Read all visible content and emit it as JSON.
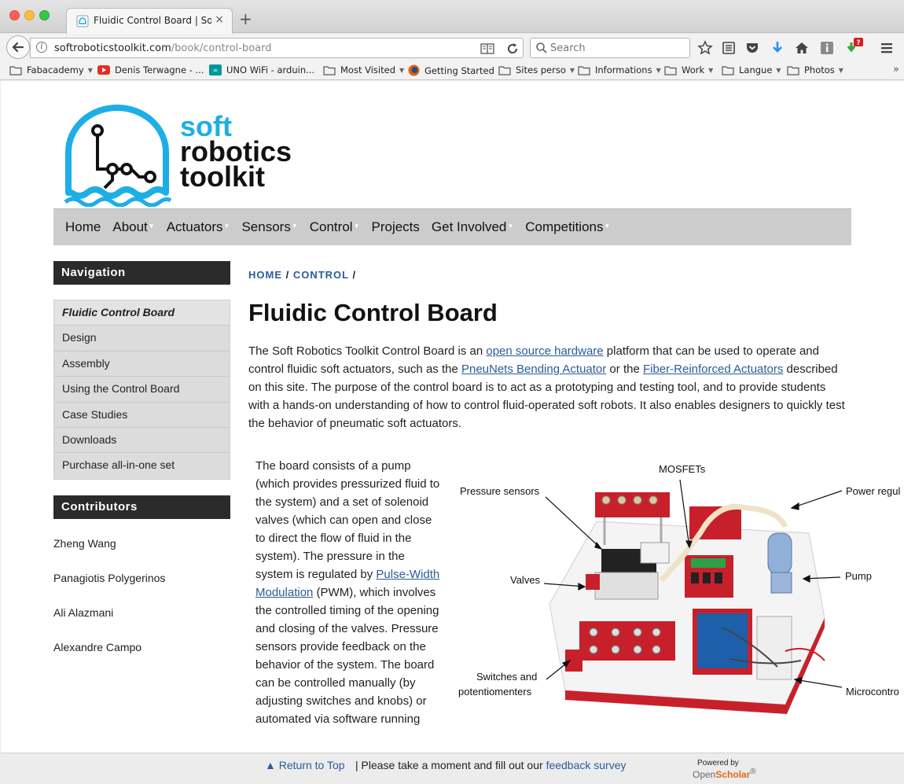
{
  "browser": {
    "tab_title": "Fluidic Control Board | Soft Ro",
    "url_host": "softroboticstoolkit.com",
    "url_path": "/book/control-board",
    "search_placeholder": "Search",
    "update_badge": "?"
  },
  "bookmarks": [
    {
      "label": "Fabacademy",
      "caret": true,
      "icon": "folder-icon"
    },
    {
      "label": "Denis Terwagne - ...",
      "caret": false,
      "icon": "youtube-icon"
    },
    {
      "label": "UNO WiFi - arduin...",
      "caret": false,
      "icon": "arduino-icon"
    },
    {
      "label": "Most Visited",
      "caret": true,
      "icon": "folder-icon"
    },
    {
      "label": "Getting Started",
      "caret": false,
      "icon": "firefox-icon"
    },
    {
      "label": "Sites perso",
      "caret": true,
      "icon": "folder-icon"
    },
    {
      "label": "Informations",
      "caret": true,
      "icon": "folder-icon"
    },
    {
      "label": "Work",
      "caret": true,
      "icon": "folder-icon"
    },
    {
      "label": "Langue",
      "caret": true,
      "icon": "folder-icon"
    },
    {
      "label": "Photos",
      "caret": true,
      "icon": "folder-icon"
    }
  ],
  "logo": {
    "line1": "soft",
    "line2": "robotics",
    "line3": "toolkit"
  },
  "menu": [
    {
      "label": "Home",
      "caret": false
    },
    {
      "label": "About",
      "caret": true
    },
    {
      "label": "Actuators",
      "caret": true
    },
    {
      "label": "Sensors",
      "caret": true
    },
    {
      "label": "Control",
      "caret": true
    },
    {
      "label": "Projects",
      "caret": false
    },
    {
      "label": "Get Involved",
      "caret": true
    },
    {
      "label": "Competitions",
      "caret": true
    }
  ],
  "sidebar": {
    "nav_heading": "Navigation",
    "nav_items": [
      {
        "label": "Fluidic Control Board",
        "active": true
      },
      {
        "label": "Design",
        "active": false
      },
      {
        "label": "Assembly",
        "active": false
      },
      {
        "label": "Using the Control Board",
        "active": false
      },
      {
        "label": "Case Studies",
        "active": false
      },
      {
        "label": "Downloads",
        "active": false
      },
      {
        "label": "Purchase all-in-one set",
        "active": false
      }
    ],
    "contributors_heading": "Contributors",
    "contributors": [
      "Zheng Wang",
      "Panagiotis Polygerinos",
      "Ali Alazmani",
      "Alexandre Campo"
    ]
  },
  "breadcrumb": {
    "home": "HOME",
    "sep": " / ",
    "control": "CONTROL",
    "trail": " /"
  },
  "article": {
    "title": "Fluidic Control Board",
    "intro": {
      "t1": "The Soft Robotics Toolkit Control Board is an ",
      "l1": "open source hardware",
      "t2": " platform that can be used to operate and control fluidic soft actuators, such as the ",
      "l2": "PneuNets Bending Actuator",
      "t3": " or the ",
      "l3": "Fiber-Reinforced Actuators",
      "t4": " described on this site. The purpose of the control board is to act as a prototyping and testing tool, and to provide students with a hands-on understanding of how to control fluid-operated soft robots. It also enables designers to quickly test the behavior of pneumatic soft actuators."
    },
    "body": {
      "t1": "The board consists of a pump (which provides pressurized fluid to the system) and a set of solenoid valves (which can open and close to direct the flow of fluid in the system). The pressure in the system is regulated by ",
      "l1": "Pulse-Width Modulation",
      "t2": " (PWM), which involves the controlled timing of the opening and closing of the valves. Pressure sensors provide feedback on the behavior of the system. The board can be controlled manually (by adjusting switches and knobs) or automated via software running"
    }
  },
  "figure": {
    "mosfets": "MOSFETs",
    "pressure_sensors": "Pressure sensors",
    "power_regulator": "Power regul",
    "valves": "Valves",
    "pump": "Pump",
    "switches_1": "Switches and",
    "switches_2": "potentiomenters",
    "microcontroller": "Microcontro"
  },
  "footer": {
    "return_top": "▲ Return to Top",
    "divider": "|",
    "survey_text": " Please take a moment and fill out our ",
    "survey_link": "feedback survey",
    "powered_by": "Powered by",
    "open": "Open",
    "scholar": "Scholar",
    "reg": "®"
  },
  "colors": {
    "accent_blue": "#1eaee6",
    "link": "#2a5c97",
    "board_red": "#c8202a"
  }
}
